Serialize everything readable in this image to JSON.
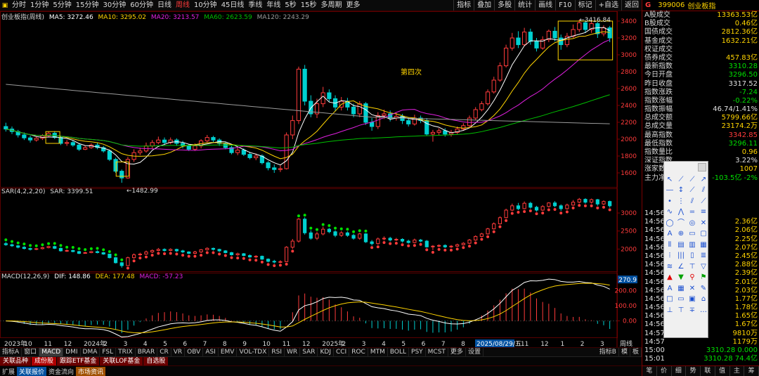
{
  "toolbar": {
    "timeframes": [
      "分时",
      "1分钟",
      "5分钟",
      "15分钟",
      "30分钟",
      "60分钟",
      "日线",
      "周线",
      "10分钟",
      "45日线",
      "季线",
      "年线",
      "5秒",
      "15秒",
      "多周期",
      "更多"
    ],
    "active_timeframe": "周线",
    "tools": [
      "指标",
      "叠加",
      "多股",
      "统计",
      "画线",
      "F10",
      "标记",
      "+自选",
      "返回"
    ]
  },
  "chart": {
    "legend_main": {
      "name": "创业板指(周线)",
      "ma5": "MA5: 3272.46",
      "ma10": "MA10: 3295.02",
      "ma20": "MA20: 3213.57",
      "ma60": "MA60: 2623.59",
      "ma120": "MA120: 2243.29"
    },
    "legend_sar": {
      "name": "SAR(4,2,2,20)",
      "value": "SAR: 3399.51"
    },
    "legend_macd": {
      "name": "MACD(12,26,9)",
      "dif": "DIF: 148.86",
      "dea": "DEA: 177.48",
      "macd": "MACD: -57.23"
    },
    "annotations": {
      "high": "3416.84",
      "low": "1482.99",
      "note": "第四次"
    },
    "price_axis": [
      "3400",
      "3200",
      "3000",
      "2800",
      "2600",
      "2400",
      "2200",
      "2000",
      "1800",
      "1600"
    ],
    "sar_axis": [
      "3000",
      "2500",
      "2000"
    ],
    "macd_axis": [
      "270.9",
      "200.00",
      "100.00",
      "0.00"
    ],
    "macd_axis_highlight": "270.9",
    "date_axis": [
      "2023年",
      "10",
      "11",
      "12",
      "2024年",
      "2",
      "3",
      "4",
      "5",
      "6",
      "7",
      "8",
      "9",
      "10",
      "11",
      "12",
      "2025年",
      "2",
      "3",
      "4",
      "5",
      "6",
      "7",
      "8",
      "9",
      "10",
      "11",
      "12",
      "1",
      "2",
      "3"
    ],
    "date_axis_highlight": "2025/08/29/五",
    "axis_label_right": "周线"
  },
  "chart_data": {
    "type": "candlestick",
    "series_note": "weekly OHLC of 创业板指, approximate values read from price axis",
    "high_label": "3416.84",
    "low_label": "1482.99",
    "ylim": [
      1500,
      3450
    ],
    "candles": [
      [
        2150,
        2120,
        2195,
        2090
      ],
      [
        2120,
        2090,
        2150,
        2060
      ],
      [
        2090,
        2050,
        2110,
        2020
      ],
      [
        2050,
        2015,
        2080,
        1990
      ],
      [
        2015,
        1990,
        2040,
        1960
      ],
      [
        1990,
        2010,
        2030,
        1970
      ],
      [
        2010,
        2040,
        2060,
        1990
      ],
      [
        2040,
        2070,
        2090,
        2020
      ],
      [
        2070,
        2020,
        2095,
        2000
      ],
      [
        2020,
        1950,
        2040,
        1930
      ],
      [
        1950,
        1960,
        1990,
        1920
      ],
      [
        1960,
        1930,
        1985,
        1910
      ],
      [
        1930,
        1880,
        1950,
        1860
      ],
      [
        1880,
        1900,
        1925,
        1870
      ],
      [
        1900,
        1930,
        1950,
        1885
      ],
      [
        1930,
        1900,
        1960,
        1880
      ],
      [
        1900,
        1860,
        1920,
        1840
      ],
      [
        1860,
        1760,
        1870,
        1740
      ],
      [
        1760,
        1620,
        1780,
        1600
      ],
      [
        1620,
        1540,
        1640,
        1483
      ],
      [
        1540,
        1760,
        1790,
        1530
      ],
      [
        1760,
        1840,
        1880,
        1730
      ],
      [
        1840,
        1860,
        1900,
        1810
      ],
      [
        1860,
        1920,
        1960,
        1840
      ],
      [
        1920,
        1960,
        1990,
        1890
      ],
      [
        1960,
        1990,
        2030,
        1940
      ],
      [
        1990,
        1960,
        2020,
        1930
      ],
      [
        1960,
        1990,
        2020,
        1940
      ],
      [
        1990,
        1950,
        2010,
        1920
      ],
      [
        1950,
        1920,
        1980,
        1890
      ],
      [
        1920,
        1880,
        1940,
        1860
      ],
      [
        1880,
        1920,
        1950,
        1860
      ],
      [
        1920,
        1980,
        2000,
        1890
      ],
      [
        1980,
        2020,
        2050,
        1960
      ],
      [
        2020,
        1990,
        2040,
        1960
      ],
      [
        1990,
        1950,
        2010,
        1920
      ],
      [
        1950,
        1900,
        1970,
        1880
      ],
      [
        1900,
        1840,
        1920,
        1820
      ],
      [
        1840,
        1870,
        1900,
        1810
      ],
      [
        1870,
        1820,
        1890,
        1800
      ],
      [
        1820,
        1780,
        1850,
        1760
      ],
      [
        1780,
        1800,
        1830,
        1750
      ],
      [
        1800,
        1720,
        1820,
        1700
      ],
      [
        1720,
        1660,
        1740,
        1630
      ],
      [
        1660,
        1640,
        1700,
        1600
      ],
      [
        1640,
        1650,
        1690,
        1610
      ],
      [
        1650,
        2050,
        2080,
        1640
      ],
      [
        2050,
        2220,
        2280,
        2000
      ],
      [
        2220,
        2830,
        2860,
        2180
      ],
      [
        2830,
        2450,
        2880,
        2400
      ],
      [
        2450,
        2300,
        2520,
        2260
      ],
      [
        2300,
        2420,
        2480,
        2250
      ],
      [
        2420,
        2550,
        2620,
        2380
      ],
      [
        2550,
        2480,
        2590,
        2440
      ],
      [
        2480,
        2380,
        2520,
        2330
      ],
      [
        2380,
        2450,
        2500,
        2340
      ],
      [
        2450,
        2380,
        2490,
        2340
      ],
      [
        2380,
        2300,
        2420,
        2260
      ],
      [
        2300,
        2420,
        2450,
        2260
      ],
      [
        2420,
        2200,
        2440,
        2170
      ],
      [
        2200,
        2150,
        2250,
        2100
      ],
      [
        2150,
        2280,
        2320,
        2120
      ],
      [
        2280,
        2300,
        2350,
        2240
      ],
      [
        2300,
        2250,
        2340,
        2210
      ],
      [
        2250,
        2270,
        2310,
        2220
      ],
      [
        2270,
        2220,
        2300,
        2180
      ],
      [
        2220,
        2180,
        2260,
        2150
      ],
      [
        2180,
        2250,
        2290,
        2160
      ],
      [
        2250,
        2220,
        2280,
        2190
      ],
      [
        2220,
        2060,
        2250,
        2040
      ],
      [
        2060,
        2080,
        2110,
        1970
      ],
      [
        2080,
        2100,
        2130,
        2050
      ],
      [
        2100,
        2060,
        2130,
        2030
      ],
      [
        2060,
        2080,
        2110,
        2030
      ],
      [
        2080,
        2120,
        2150,
        2060
      ],
      [
        2120,
        2160,
        2190,
        2100
      ],
      [
        2160,
        2250,
        2280,
        2140
      ],
      [
        2250,
        2350,
        2380,
        2230
      ],
      [
        2350,
        2420,
        2450,
        2330
      ],
      [
        2420,
        2560,
        2590,
        2400
      ],
      [
        2560,
        2700,
        2740,
        2540
      ],
      [
        2700,
        2870,
        2910,
        2680
      ],
      [
        2870,
        3080,
        3120,
        2850
      ],
      [
        3080,
        3200,
        3260,
        3050
      ],
      [
        3200,
        3120,
        3280,
        3080
      ],
      [
        3120,
        3270,
        3320,
        3100
      ],
      [
        3270,
        3160,
        3310,
        3120
      ],
      [
        3160,
        3080,
        3200,
        3040
      ],
      [
        3080,
        3180,
        3220,
        3060
      ],
      [
        3180,
        3280,
        3300,
        3150
      ],
      [
        3280,
        3200,
        3330,
        3160
      ],
      [
        3200,
        3120,
        3240,
        3060
      ],
      [
        3120,
        3220,
        3260,
        3090
      ],
      [
        3220,
        3300,
        3360,
        3200
      ],
      [
        3300,
        3380,
        3417,
        3270
      ],
      [
        3380,
        3300,
        3410,
        3260
      ],
      [
        3300,
        3370,
        3400,
        3260
      ],
      [
        3370,
        3250,
        3390,
        3200
      ],
      [
        3250,
        3320,
        3350,
        3220
      ],
      [
        3320,
        3200,
        3343,
        3150
      ]
    ]
  },
  "panel": {
    "tag": "G",
    "code": "399006",
    "name": "创业板指",
    "stats": [
      {
        "k": "A股成交",
        "v": "13363.53亿",
        "c": "yellow"
      },
      {
        "k": "B股成交",
        "v": "0.46亿",
        "c": "yellow"
      },
      {
        "k": "国债成交",
        "v": "2812.36亿",
        "c": "yellow"
      },
      {
        "k": "基金成交",
        "v": "1632.21亿",
        "c": "yellow"
      },
      {
        "k": "权证成交",
        "v": "",
        "c": "yellow"
      },
      {
        "k": "债券成交",
        "v": "457.83亿",
        "c": "yellow"
      },
      {
        "k": "最新指数",
        "v": "3310.28",
        "c": "green"
      },
      {
        "k": "今日开盘",
        "v": "3296.50",
        "c": "green"
      },
      {
        "k": "昨日收盘",
        "v": "3317.52",
        "c": "white"
      },
      {
        "k": "指数涨跌",
        "v": "-7.24",
        "c": "green"
      },
      {
        "k": "指数涨幅",
        "v": "-0.22%",
        "c": "green"
      },
      {
        "k": "指数振幅",
        "v": "46.74/1.41%",
        "c": "white"
      },
      {
        "k": "总成交额",
        "v": "5799.66亿",
        "c": "yellow"
      },
      {
        "k": "总成交量",
        "v": "23174.2万",
        "c": "yellow"
      },
      {
        "k": "最高指数",
        "v": "3342.85",
        "c": "red"
      },
      {
        "k": "最低指数",
        "v": "3296.11",
        "c": "green"
      },
      {
        "k": "指数量比",
        "v": "0.96",
        "c": "yellow"
      },
      {
        "k": "深证指数",
        "v": "3.22%",
        "c": "white"
      },
      {
        "k": "涨家数",
        "v": "1007",
        "c": "yellow"
      },
      {
        "k": "主力净额",
        "v": "-103.5亿 -2%",
        "c": "green"
      }
    ],
    "ticks": [
      {
        "t": "14:56",
        "v": "",
        "c": "red"
      },
      {
        "t": "14:56",
        "v": "2.36亿",
        "c": "yellow"
      },
      {
        "t": "14:56",
        "v": "2.06亿",
        "c": "yellow"
      },
      {
        "t": "14:56",
        "v": "2.25亿",
        "c": "yellow"
      },
      {
        "t": "14:56",
        "v": "2.07亿",
        "c": "yellow"
      },
      {
        "t": "14:56",
        "v": "2.45亿",
        "c": "yellow"
      },
      {
        "t": "14:56",
        "v": "2.88亿",
        "c": "yellow"
      },
      {
        "t": "14:56",
        "v": "2.39亿",
        "c": "yellow"
      },
      {
        "t": "14:56",
        "v": "2.01亿",
        "c": "yellow"
      },
      {
        "t": "14:56",
        "v": "2.03亿",
        "c": "yellow"
      },
      {
        "t": "14:56",
        "v": "1.77亿",
        "c": "yellow"
      },
      {
        "t": "14:56",
        "v": "1.78亿",
        "c": "yellow"
      },
      {
        "t": "14:56",
        "v": "1.65亿",
        "c": "yellow"
      },
      {
        "t": "14:56",
        "v": "1.67亿",
        "c": "yellow"
      },
      {
        "t": "14:57",
        "v": "9810万",
        "c": "yellow"
      },
      {
        "t": "14:57",
        "v": "1179万",
        "c": "yellow"
      },
      {
        "t": "15:00",
        "v": "3310.28 0.000",
        "c": "green"
      },
      {
        "t": "15:01",
        "v": "3310.28 74.4亿",
        "c": "green"
      }
    ],
    "bottom_tabs": [
      "笔",
      "价",
      "细",
      "势",
      "联",
      "值",
      "主",
      "筹"
    ]
  },
  "bottom": {
    "indicator_tabs": [
      "指标A",
      "窗口",
      "MACD",
      "DMI",
      "DMA",
      "FSL",
      "TRIX",
      "BRAR",
      "CR",
      "VR",
      "OBV",
      "ASI",
      "EMV",
      "VOL-TDX",
      "RSI",
      "WR",
      "SAR",
      "KDJ",
      "CCI",
      "ROC",
      "MTM",
      "BOLL",
      "PSY",
      "MCST",
      "更多",
      "设置"
    ],
    "active_indicator": "MACD",
    "right_tabs": [
      "指标B",
      "模",
      "板"
    ],
    "sector_tabs": [
      {
        "label": "关联品种",
        "bg": "#6a0000"
      },
      {
        "label": "成份股",
        "bg": "#b00000"
      },
      {
        "label": "跟踪ETF基金",
        "bg": "#6a0000"
      },
      {
        "label": "关联LOF基金",
        "bg": "#6a0000"
      },
      {
        "label": "自选股",
        "bg": "#6a0000"
      }
    ],
    "status": [
      {
        "label": "扩展",
        "cls": ""
      },
      {
        "label": "关联报价",
        "cls": "hl"
      },
      {
        "label": "资金流向",
        "cls": ""
      },
      {
        "label": "市场资讯",
        "cls": "hl2"
      }
    ]
  },
  "colors": {
    "up": "#ff3b3b",
    "down": "#00d0d0",
    "ma5": "#ffffff",
    "ma10": "#ffd400",
    "ma20": "#e020e0",
    "ma60": "#00c000",
    "ma120": "#9a9a9a",
    "grid": "#5a0000"
  },
  "drawtools": {
    "icons": [
      "cursor-icon",
      "line-icon",
      "ray-icon",
      "arrow-icon",
      "hline-icon",
      "vline-icon",
      "segment-icon",
      "parallel-icon",
      "point-icon",
      "vgrid-icon",
      "channel-icon",
      "fan-icon",
      "wave-icon",
      "mountain-icon",
      "eq-icon",
      "fib-icon",
      "circle-icon",
      "arc-icon",
      "spiral-icon",
      "gann-icon",
      "text-icon",
      "cycle-icon",
      "box-icon",
      "square-icon",
      "gold-icon",
      "ratio-icon",
      "pct-icon",
      "fib2-icon",
      "period-icon",
      "time-icon",
      "range-icon",
      "stripe-icon",
      "speed-icon",
      "angle-icon",
      "resist-icon",
      "triangle-icon",
      "uparrow-icon",
      "downarrow-icon",
      "mark-icon",
      "flag-icon",
      "textA-icon",
      "copy-icon",
      "delete-icon",
      "edit-icon",
      "memo-icon",
      "rect-icon",
      "note-icon",
      "hat-icon",
      "updown-icon",
      "level-icon",
      "scale-icon",
      "more-icon"
    ],
    "glyphs": [
      "↖",
      "⟋",
      "⟋",
      "↗",
      "―",
      "↕",
      "⟋",
      "⫽",
      "•",
      "⋮",
      "⫽",
      "⟋",
      "∿",
      "⋀",
      "=",
      "≡",
      "◯",
      "⌒",
      "◎",
      "✕",
      "A",
      "⊕",
      "▭",
      "▢",
      "⦀",
      "▤",
      "▥",
      "▦",
      "⦙",
      "|||",
      "▯",
      "≣",
      "≋",
      "∠",
      "⊤",
      "▽",
      "▲",
      "▼",
      "⚲",
      "⚑",
      "A",
      "▦",
      "✕",
      "✎",
      "□",
      "▭",
      "▣",
      "⌂",
      "⊥",
      "⊤",
      "∓",
      "…"
    ]
  }
}
